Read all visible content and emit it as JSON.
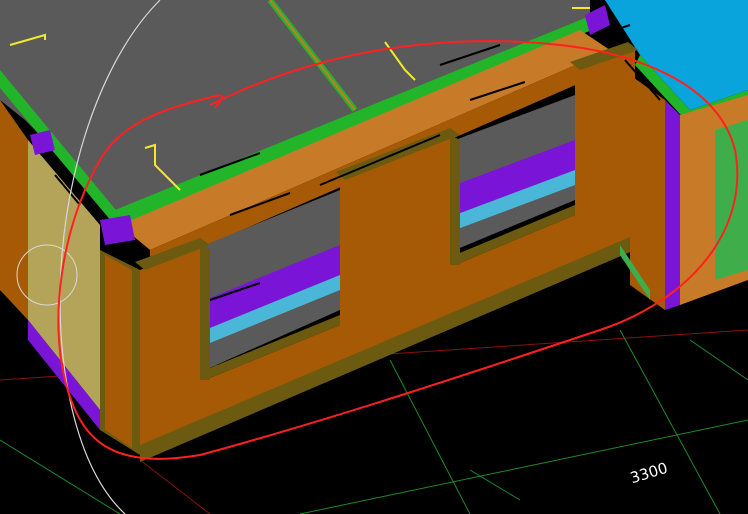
{
  "viewport": {
    "background": "#000000"
  },
  "dimension": {
    "label": "3300"
  },
  "colors": {
    "roof": "#5a5a5a",
    "wall_orange": "#a65a05",
    "wall_face": "#c77a28",
    "wall_shadow": "#6b5a10",
    "green_edge": "#22b52a",
    "purple": "#7a14d6",
    "cyan": "#4ab7d9",
    "blue_roof": "#0aa4dd",
    "markup_red": "#ff2020",
    "grid_green": "#1f8a2a",
    "grid_red": "#8a1010"
  },
  "icons": {
    "snap_circle": "snap-circle-icon"
  }
}
